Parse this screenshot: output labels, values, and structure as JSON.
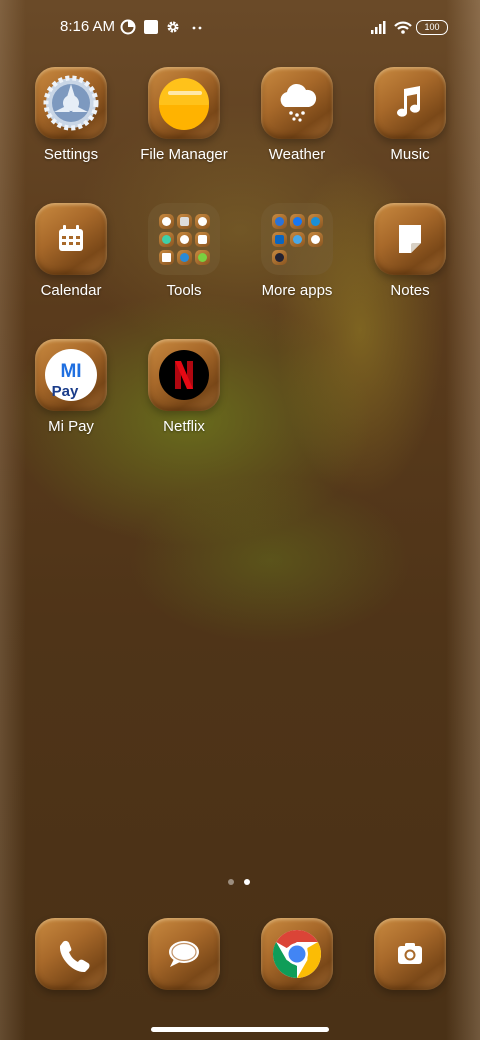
{
  "status_bar": {
    "time": "8:16 AM",
    "battery": "100"
  },
  "apps": {
    "row1": [
      "Settings",
      "File Manager",
      "Weather",
      "Music"
    ],
    "row2": [
      "Calendar",
      "Tools",
      "More apps",
      "Notes"
    ],
    "row3": [
      "Mi Pay",
      "Netflix"
    ]
  },
  "mipay_logo": "MI Pay",
  "page_indicator": {
    "pages": 2,
    "current": 2
  },
  "dock": [
    "Phone",
    "Messages",
    "Chrome",
    "Camera"
  ],
  "colors": {
    "tile_accent": "#b87a35",
    "file_manager_yellow": "#ffc21a",
    "netflix_red": "#e50914"
  }
}
